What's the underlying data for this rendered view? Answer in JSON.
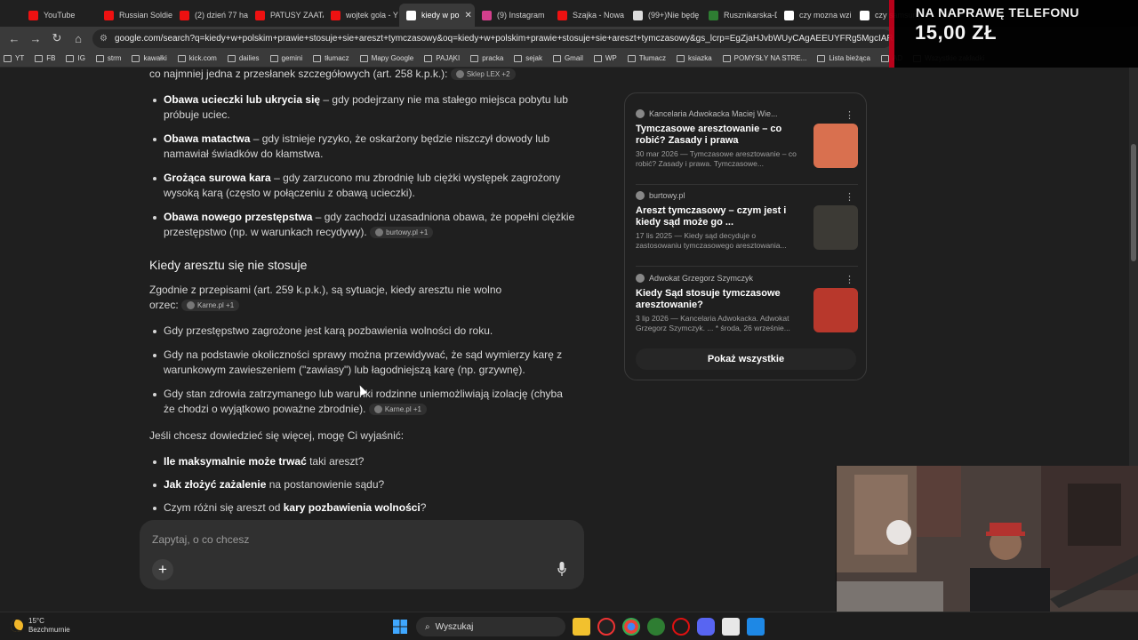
{
  "tabs": [
    {
      "label": "YouTube",
      "color": "#e11"
    },
    {
      "label": "Russian Soldier",
      "color": "#e11"
    },
    {
      "label": "(2) dzień 77 ha",
      "color": "#e11"
    },
    {
      "label": "PATUSY ZAATA",
      "color": "#e11"
    },
    {
      "label": "wojtek gola - Y",
      "color": "#e11"
    },
    {
      "label": "kiedy w po",
      "color": "#fff",
      "active": true
    },
    {
      "label": "(9) Instagram",
      "color": "#d43f8d"
    },
    {
      "label": "Szajka - Nowa",
      "color": "#e11"
    },
    {
      "label": "(99+)Nie będę",
      "color": "#ddd"
    },
    {
      "label": "Rusznikarska-D",
      "color": "#2e7d32"
    },
    {
      "label": "czy mozna wzi",
      "color": "#fff"
    },
    {
      "label": "czy samsun",
      "color": "#fff"
    }
  ],
  "nav": {
    "back": "←",
    "forward": "→",
    "reload": "↻",
    "home": "⌂"
  },
  "url": "google.com/search?q=kiedy+w+polskim+prawie+stosuje+sie+areszt+tymczasowy&oq=kiedy+w+polskim+prawie+stosuje+sie+areszt+tymczasowy&gs_lcrp=EgZjaHJvbWUyCAgAEEUYFRg5MgcIARAhGI8FMgc",
  "bookmarks": [
    "YT",
    "FB",
    "IG",
    "strm",
    "kawałki",
    "kick.com",
    "dailies",
    "gemini",
    "tłumacz",
    "Mapy Google",
    "PAJĄKI",
    "pracka",
    "sejak",
    "Gmail",
    "WP",
    "Tłumacz",
    "ksiazka",
    "POMYSŁY NA STRE...",
    "Lista bieżąca",
    "AD",
    "Wszystkie zakładki"
  ],
  "overlay": {
    "line1": "NA NAPRAWĘ TELEFONU",
    "line2": "15,00 ZŁ"
  },
  "article": {
    "intro": "co najmniej jedna z przesłanek szczegółowych (art. 258 k.p.k.):",
    "intro_chip": "Sklep LEX +2",
    "grounds": [
      {
        "bold": "Obawa ucieczki lub ukrycia się",
        "text": " – gdy podejrzany nie ma stałego miejsca pobytu lub próbuje uciec."
      },
      {
        "bold": "Obawa matactwa",
        "text": " – gdy istnieje ryzyko, że oskarżony będzie niszczył dowody lub namawiał świadków do kłamstwa."
      },
      {
        "bold": "Grożąca surowa kara",
        "text": " – gdy zarzucono mu zbrodnię lub ciężki występek zagrożony wysoką karą (często w połączeniu z obawą ucieczki)."
      },
      {
        "bold": "Obawa nowego przestępstwa",
        "text": " – gdy zachodzi uzasadniona obawa, że popełni ciężkie przestępstwo (np. w warunkach recydywy).",
        "chip": "burtowy.pl +1"
      }
    ],
    "h2": "Kiedy aresztu się nie stosuje",
    "para": "Zgodnie z przepisami (art. 259 k.p.k.), są sytuacje, kiedy aresztu nie wolno orzec:",
    "para_chip": "Karne.pl +1",
    "exceptions": [
      {
        "text": "Gdy przestępstwo zagrożone jest karą pozbawienia wolności do roku."
      },
      {
        "text": "Gdy na podstawie okoliczności sprawy można przewidywać, że sąd wymierzy karę z warunkowym zawieszeniem (\"zawiasy\") lub łagodniejszą karę (np. grzywnę)."
      },
      {
        "text": "Gdy stan zdrowia zatrzymanego lub warunki rodzinne uniemożliwiają izolację (chyba że chodzi o wyjątkowo poważne zbrodnie).",
        "chip": "Karne.pl +1"
      }
    ],
    "more": "Jeśli chcesz dowiedzieć się więcej, mogę Ci wyjaśnić:",
    "questions": [
      {
        "bold": "Ile maksymalnie może trwać",
        "text": " taki areszt?"
      },
      {
        "bold": "Jak złożyć zażalenie",
        "text": " na postanowienie sądu?"
      },
      {
        "pre": "Czym różni się areszt od ",
        "bold": "kary pozbawienia wolności",
        "text": "?"
      }
    ]
  },
  "sources": [
    {
      "site": "Kancelaria Adwokacka Maciej Wie...",
      "title": "Tymczasowe aresztowanie – co robić? Zasady i prawa",
      "snippet": "30 mar 2026 — Tymczasowe aresztowanie – co robić? Zasady i prawa. Tymczasowe...",
      "thumb": "#d9704f"
    },
    {
      "site": "burtowy.pl",
      "title": "Areszt tymczasowy – czym jest i kiedy sąd może go ...",
      "snippet": "17 lis 2025 — Kiedy sąd decyduje o zastosowaniu tymczasowego aresztowania...",
      "thumb": "#3c3a35"
    },
    {
      "site": "Adwokat Grzegorz Szymczyk",
      "title": "Kiedy Sąd stosuje tymczasowe aresztowanie?",
      "snippet": "3 lip 2026 — Kancelaria Adwokacka. Adwokat Grzegorz Szymczyk. ... * środa, 26 wrześnie...",
      "thumb": "#b8382c"
    }
  ],
  "show_all": "Pokaż wszystkie",
  "ask": {
    "placeholder": "Zapytaj, o co chcesz",
    "plus": "+"
  },
  "taskbar": {
    "temp": "15°C",
    "weather": "Bezchmurnie",
    "search": "Wyszukaj"
  }
}
